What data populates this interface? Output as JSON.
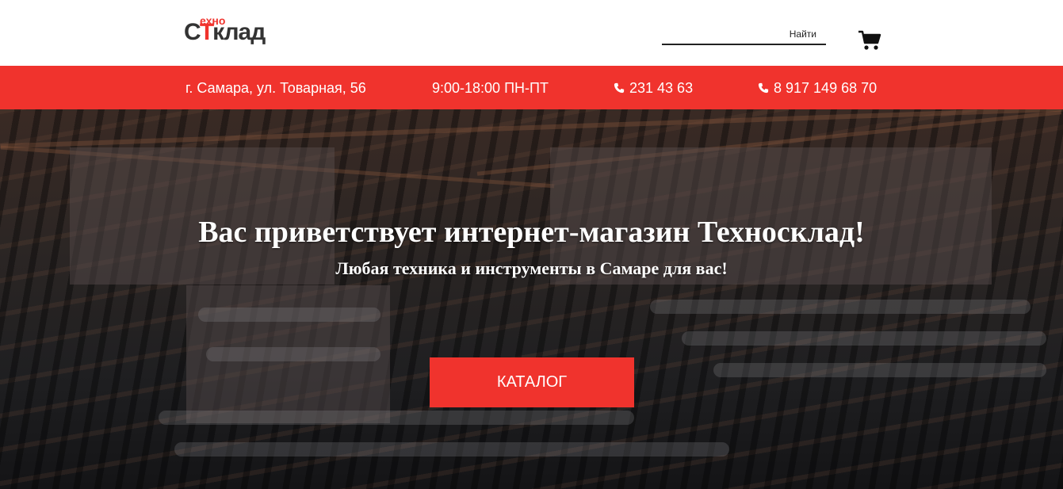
{
  "brand": {
    "logo_small": "ехно",
    "logo_prefix": "С",
    "logo_t": "Т",
    "logo_rest": "клад",
    "accent_color": "#f0332d"
  },
  "header": {
    "search_button": "Найти",
    "search_placeholder": "",
    "cart_icon": "cart-icon"
  },
  "infobar": {
    "address": "г. Самара, ул. Товарная, 56",
    "hours": "9:00-18:00 ПН-ПТ",
    "phone_1": "231 43 63",
    "phone_2": "8 917 149 68 70",
    "phone_icon": "phone-icon"
  },
  "hero": {
    "title": "Вас приветствует интернет-магазин Техносклад!",
    "subtitle": "Любая техника и инструменты в Самаре для вас!",
    "button_label": "КАТАЛОГ"
  }
}
